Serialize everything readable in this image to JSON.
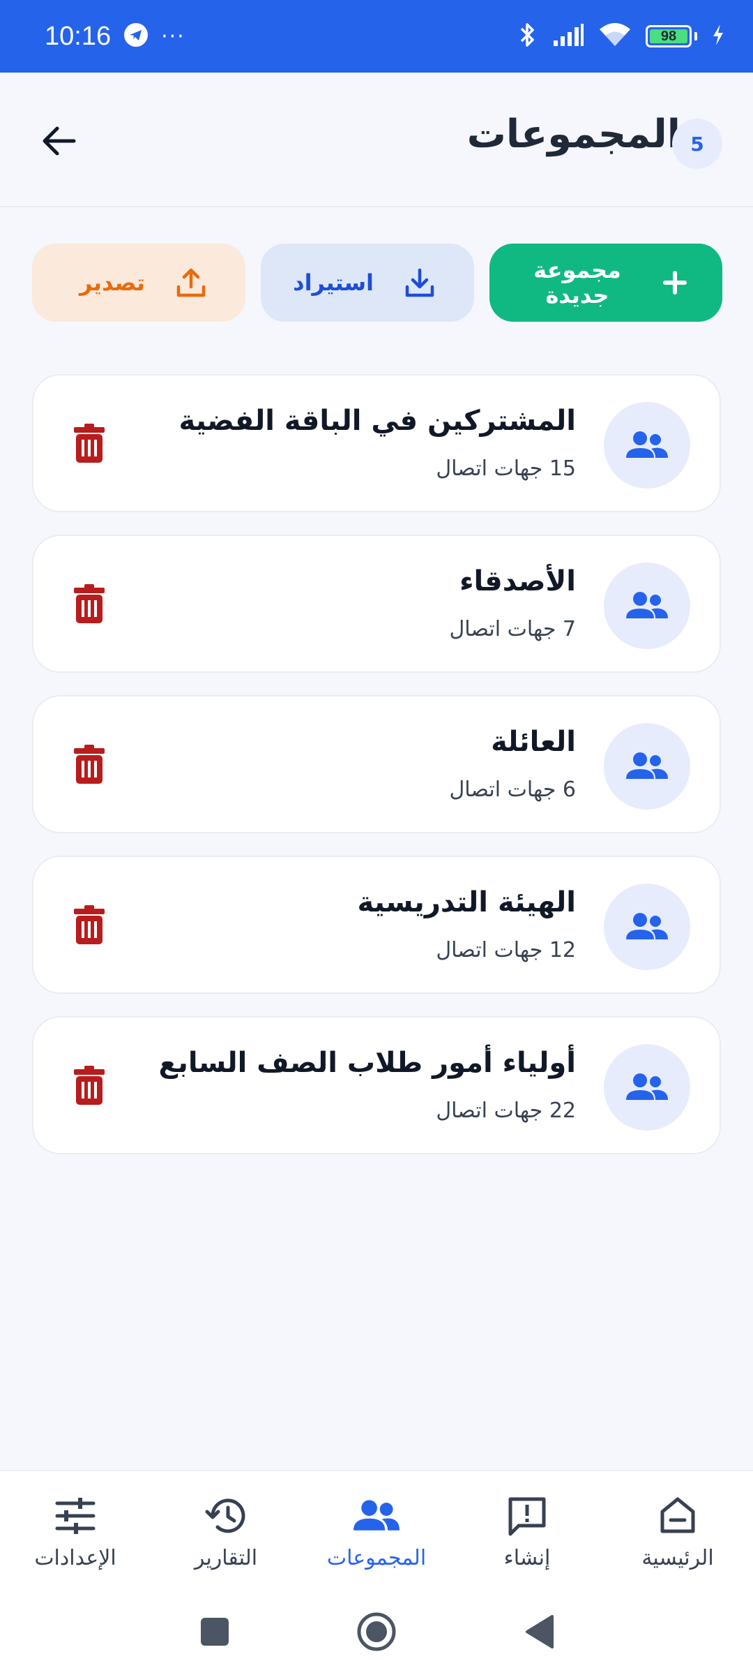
{
  "status_bar": {
    "time": "10:16",
    "dots": "···",
    "battery": "98",
    "icons": [
      "telegram-icon",
      "bluetooth-icon",
      "signal-icon",
      "wifi-icon",
      "battery-icon",
      "charging-icon"
    ]
  },
  "header": {
    "title": "المجموعات",
    "count": "5"
  },
  "actions": {
    "new_group": "مجموعة جديدة",
    "import": "استيراد",
    "export": "تصدير"
  },
  "groups": [
    {
      "name": "المشتركين في الباقة الفضية",
      "count": "15 جهات اتصال"
    },
    {
      "name": "الأصدقاء",
      "count": "7 جهات اتصال"
    },
    {
      "name": "العائلة",
      "count": "6 جهات اتصال"
    },
    {
      "name": "الهيئة التدريسية",
      "count": "12 جهات اتصال"
    },
    {
      "name": "أولياء أمور طلاب الصف السابع",
      "count": "22 جهات اتصال"
    }
  ],
  "bottom_nav": {
    "home": "الرئيسية",
    "create": "إنشاء",
    "groups": "المجموعات",
    "reports": "التقارير",
    "settings": "الإعدادات",
    "active": "groups"
  },
  "colors": {
    "primary": "#2563eb",
    "success": "#10b981",
    "danger": "#b91c1c",
    "export": "#ea6a0c"
  }
}
